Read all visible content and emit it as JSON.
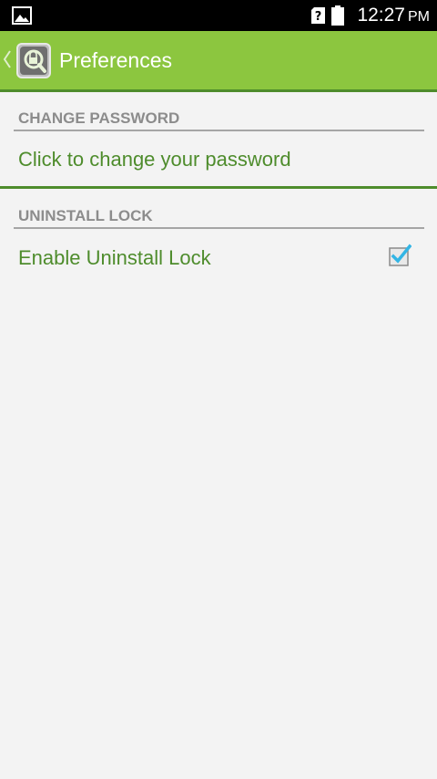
{
  "status_bar": {
    "time": "12:27",
    "ampm": "PM",
    "icons": [
      "photo-icon",
      "no-sim-icon",
      "battery-icon"
    ]
  },
  "action_bar": {
    "title": "Preferences",
    "background": "#8cc63f",
    "accent": "#4e8c2c"
  },
  "sections": [
    {
      "header": "CHANGE PASSWORD",
      "items": [
        {
          "title": "Click to change your password"
        }
      ]
    },
    {
      "header": "UNINSTALL LOCK",
      "items": [
        {
          "title": "Enable Uninstall Lock",
          "checked": true
        }
      ]
    }
  ],
  "colors": {
    "title_text": "#4e8c2c",
    "header_text": "#8c8c8c",
    "checkbox_check": "#33b5e5"
  }
}
